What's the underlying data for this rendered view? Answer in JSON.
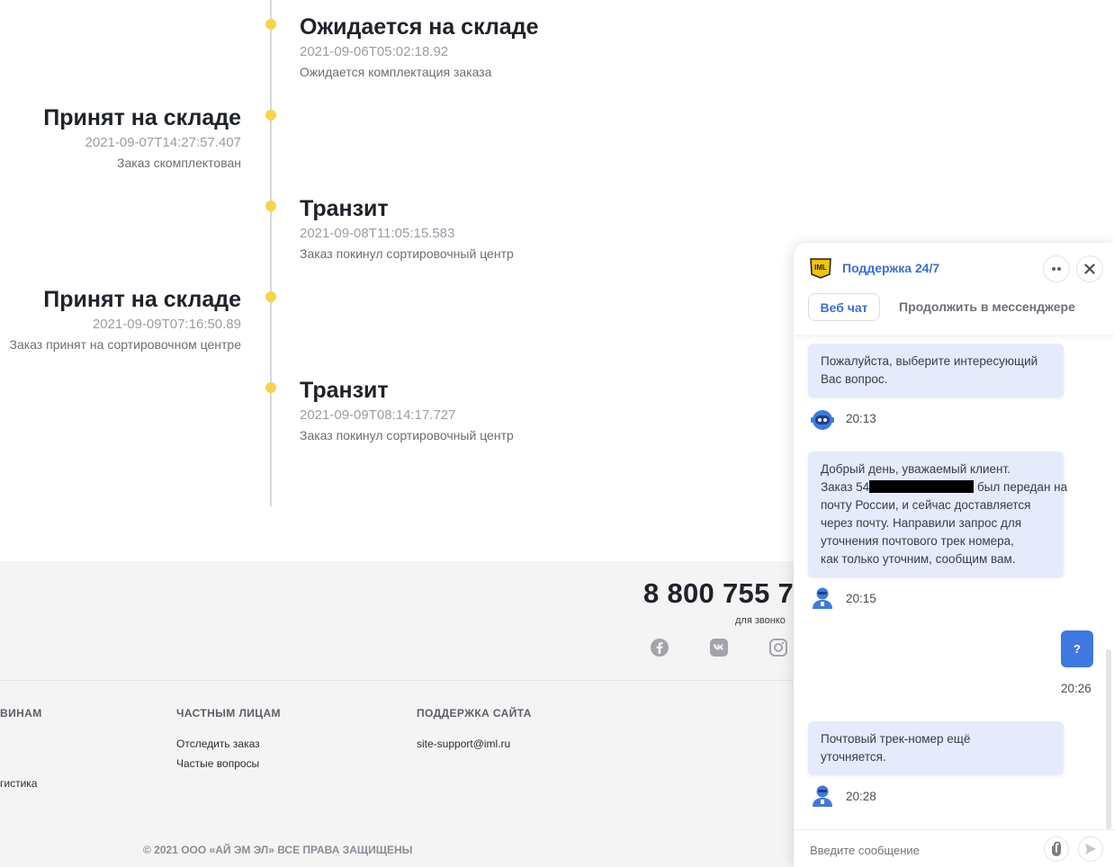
{
  "timeline": [
    {
      "title": "Ожидается на складе",
      "date": "2021-09-06T05:02:18.92",
      "desc": "Ожидается комплектация заказа"
    },
    {
      "title": "Принят на складе",
      "date": "2021-09-07T14:27:57.407",
      "desc": "Заказ скомплектован"
    },
    {
      "title": "Транзит",
      "date": "2021-09-08T11:05:15.583",
      "desc": "Заказ покинул сортировочный центр"
    },
    {
      "title": "Принят на складе",
      "date": "2021-09-09T07:16:50.89",
      "desc": "Заказ принят на сортировочном центре"
    },
    {
      "title": "Транзит",
      "date": "2021-09-09T08:14:17.727",
      "desc": "Заказ покинул сортировочный центр"
    }
  ],
  "footer": {
    "phone": "8 800 755 7",
    "phone_sub": "для звонко",
    "columns": [
      {
        "heading": "ВИНАМ",
        "links": [
          "гистика"
        ]
      },
      {
        "heading": "ЧАСТНЫМ ЛИЦАМ",
        "links": [
          "Отследить заказ",
          "Частые вопросы"
        ]
      },
      {
        "heading": "ПОДДЕРЖКА САЙТА",
        "links": [
          "site-support@iml.ru"
        ]
      }
    ],
    "copyright": "© 2021 ООО «АЙ ЭМ ЭЛ» ВСЕ ПРАВА ЗАЩИЩЕНЫ",
    "social_icons": [
      "facebook-icon",
      "vk-icon",
      "instagram-icon"
    ]
  },
  "chat": {
    "logo_text": "IML",
    "title": "Поддержка 24/7",
    "tabs": {
      "active": "Веб чат",
      "other": "Продолжить в мессенджере"
    },
    "messages": [
      {
        "lines": [
          "Пожалуйста, выберите интересующий",
          "Вас вопрос."
        ],
        "time": "20:13",
        "avatar": "bot-icon"
      },
      {
        "lines": [
          "Добрый день, уважаемый клиент.",
          "Заказ 54",
          "был передан на",
          "почту России, и сейчас доставляется",
          "через почту. Направили запрос для",
          "уточнения почтового трек номера,",
          "как только уточним, сообщим вам."
        ],
        "time": "20:15",
        "avatar": "operator-avatar-icon"
      },
      {
        "lines": [
          "Почтовый трек-номер ещё",
          "уточняется."
        ],
        "time": "20:28",
        "avatar": "operator-avatar-icon"
      }
    ],
    "user_message": {
      "text": "?",
      "time": "20:26"
    },
    "input_placeholder": "Введите сообщение",
    "colors": {
      "accent": "#3f78e0",
      "bubble": "#e5ebfb",
      "timeline_dot": "#f7d54a"
    }
  }
}
